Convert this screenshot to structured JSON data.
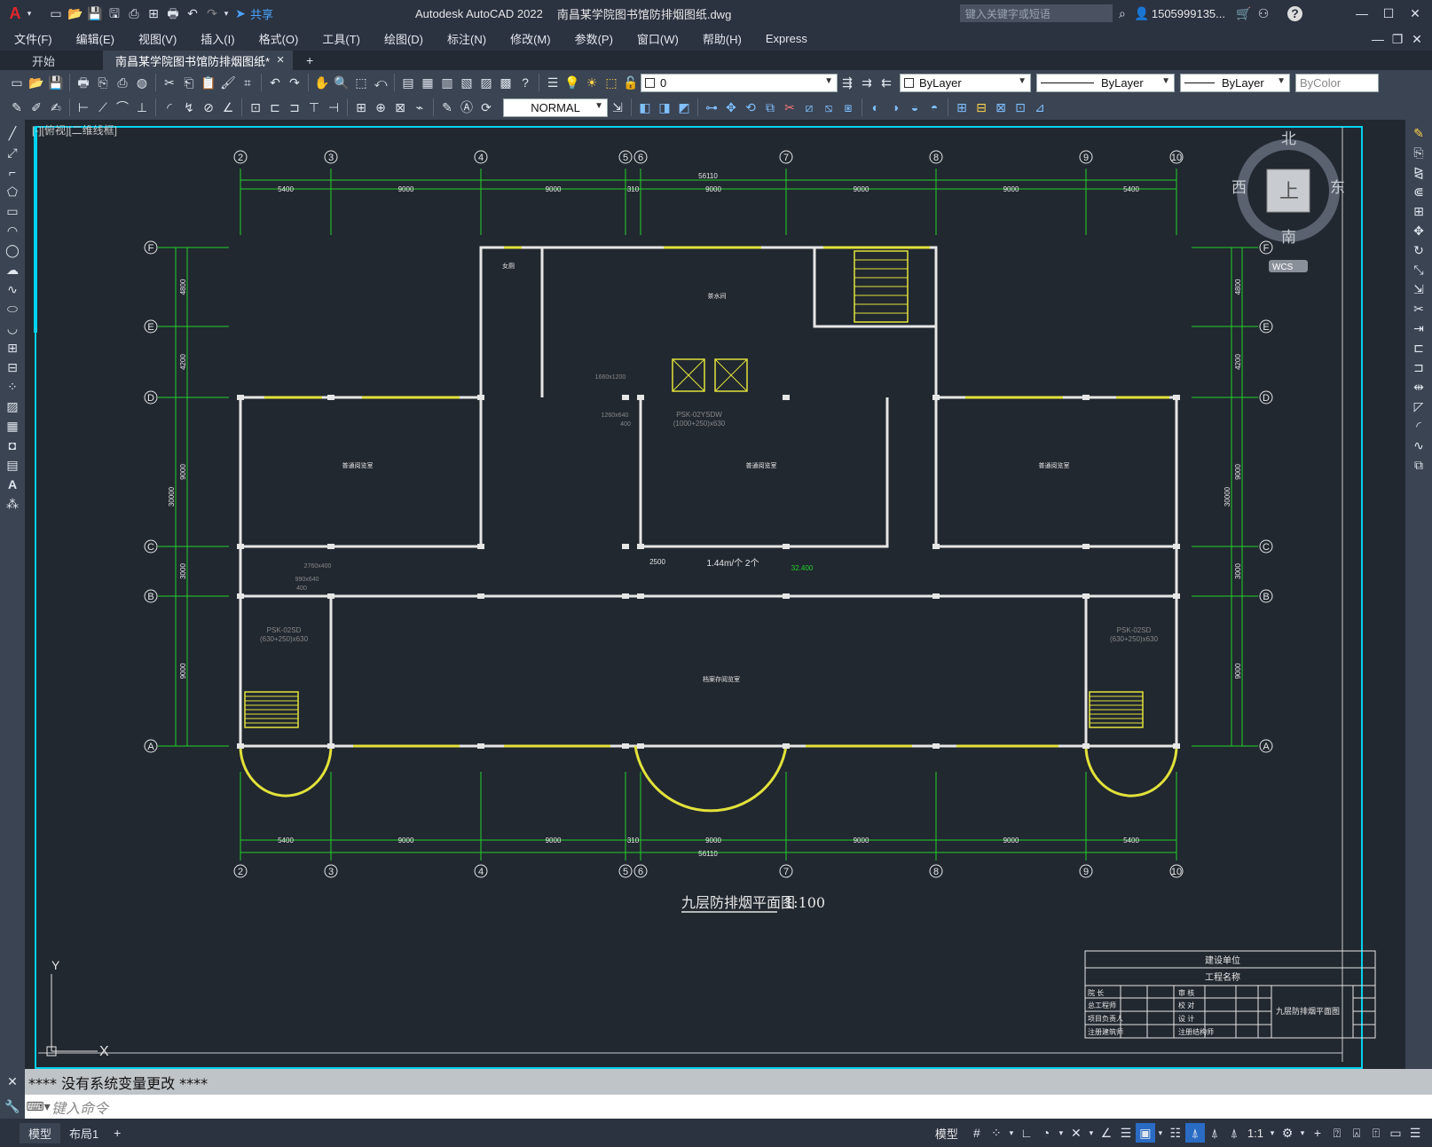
{
  "app": {
    "title": "Autodesk AutoCAD 2022",
    "doc": "南昌某学院图书馆防排烟图纸.dwg",
    "share": "共享",
    "search_placeholder": "键入关键字或短语",
    "user": "1505999135...",
    "help": "?"
  },
  "menu": [
    "文件(F)",
    "编辑(E)",
    "视图(V)",
    "插入(I)",
    "格式(O)",
    "工具(T)",
    "绘图(D)",
    "标注(N)",
    "修改(M)",
    "参数(P)",
    "窗口(W)",
    "帮助(H)",
    "Express"
  ],
  "tabs": {
    "start": "开始",
    "doc": "南昌某学院图书馆防排烟图纸*",
    "add": "+"
  },
  "toolbar": {
    "layer": "0",
    "linetype1": "ByLayer",
    "linetype2": "ByLayer",
    "linetype3": "ByLayer",
    "color": "ByColor",
    "style": "NORMAL"
  },
  "viewport": {
    "label": "[-][俯视][二维线框]"
  },
  "viewcube": {
    "north": "北",
    "south": "南",
    "east": "东",
    "west": "西",
    "top": "上",
    "wcs": "WCS"
  },
  "drawing": {
    "title": "九层防排烟平面图",
    "scale": "1:100",
    "axes_x": [
      "2",
      "3",
      "4",
      "5",
      "6",
      "7",
      "8",
      "9",
      "10"
    ],
    "axes_y": [
      "F",
      "E",
      "D",
      "C",
      "B",
      "A"
    ],
    "dims_x": [
      "5400",
      "9000",
      "9000",
      "310",
      "9000",
      "9000",
      "9000",
      "5400"
    ],
    "total_x": "56110",
    "dims_y": [
      "4800",
      "4200",
      "9000",
      "3000",
      "9000"
    ],
    "total_y": "30000",
    "labels": {
      "toilet": "女厕",
      "tearoom": "茶水间",
      "psk1": "PSK-02YSDW",
      "psk1b": "(1000+250)x630",
      "psk2": "PSK-02SD",
      "psk2b": "(630+250)x630",
      "flow": "1.44m/个 2个",
      "d2500": "2500",
      "elev": "32.400",
      "reading1": "普通阅览室",
      "reading2": "普通阅览室",
      "reading3": "普通阅览室",
      "hall": "档案存阅览室",
      "s1": "1660x1200",
      "s2": "1260x640",
      "s3": "400",
      "s4": "2760x400",
      "s5": "990x640",
      "s6": "400"
    }
  },
  "titleblock": {
    "unit": "建设单位",
    "project": "工程名称",
    "name": "九层防排烟平面图",
    "r1": [
      "院 长",
      "审 核"
    ],
    "r2": [
      "总工程师",
      "校 对"
    ],
    "r3": [
      "项目负责人",
      "设 计"
    ],
    "r4": [
      "注册建筑师",
      "注册结构师"
    ]
  },
  "cmd": {
    "log": "****  没有系统变量更改  ****",
    "placeholder": "键入命令"
  },
  "status": {
    "model": "模型",
    "layout": "布局1",
    "add": "+",
    "model_btn": "模型",
    "scale": "1:1"
  }
}
